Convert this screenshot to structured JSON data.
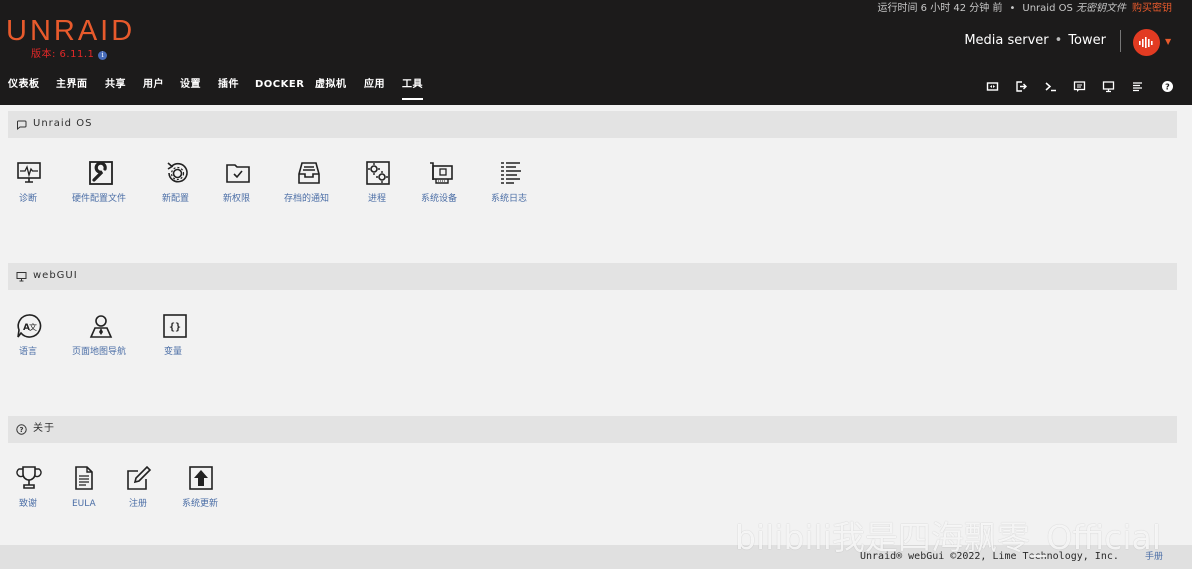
{
  "header": {
    "logo": "UNRAID",
    "version": "版本: 6.11.1",
    "uptime": "运行时间 6 小时 42 分钟 前",
    "dot": "•",
    "os_name": "Unraid OS",
    "key_status": "无密钥文件",
    "buy_key": "购买密钥",
    "server_desc": "Media server",
    "server_dot": "•",
    "server_name": "Tower",
    "brand_color": "#e85a2c"
  },
  "nav": {
    "items": [
      "仪表板",
      "主界面",
      "共享",
      "用户",
      "设置",
      "插件",
      "DOCKER",
      "虚拟机",
      "应用",
      "工具"
    ],
    "active": "工具",
    "icons": [
      "switch-language-icon",
      "logout-icon",
      "terminal-icon",
      "feedback-icon",
      "display-icon",
      "log-icon",
      "help-icon"
    ]
  },
  "sections": {
    "unraid_os": {
      "title": "Unraid OS",
      "tiles": [
        "诊断",
        "硬件配置文件",
        "新配置",
        "新权限",
        "存档的通知",
        "进程",
        "系统设备",
        "系统日志"
      ]
    },
    "webgui": {
      "title": "webGUI",
      "tiles": [
        "语言",
        "页面地图导航",
        "变量"
      ]
    },
    "about": {
      "title": "关于",
      "tiles": [
        "致谢",
        "EULA",
        "注册",
        "系统更新"
      ]
    }
  },
  "footer": {
    "copyright": "Unraid® webGui ©2022, Lime Technology, Inc.",
    "manual": "手册"
  },
  "watermark": "bilibili我是四海飘零_Official"
}
